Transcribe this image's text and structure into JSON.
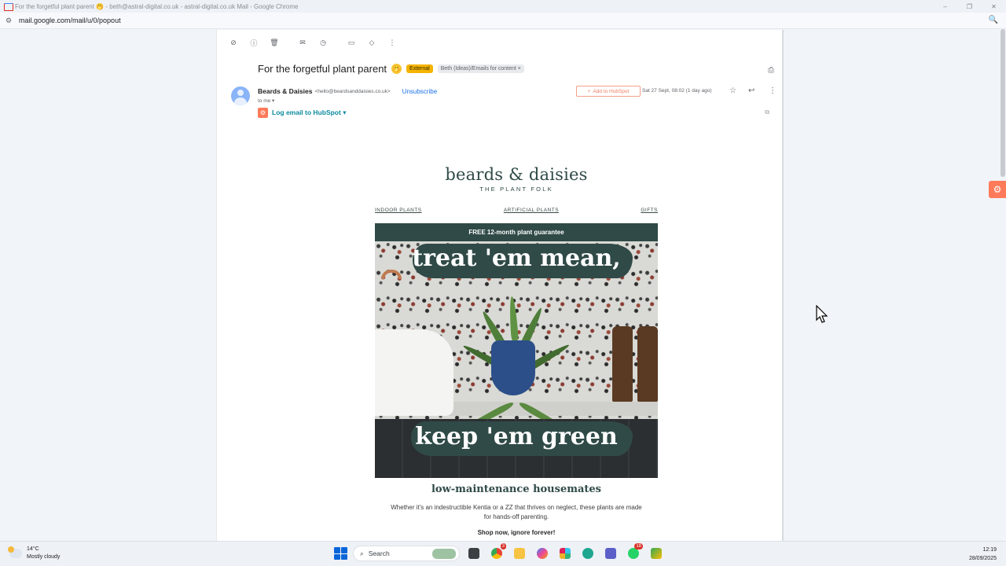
{
  "window": {
    "title": "For the forgetful plant parent 🤭 - beth@astral-digital.co.uk - astral-digital.co.uk Mail - Google Chrome",
    "minimize": "–",
    "maximize": "❐",
    "close": "✕"
  },
  "address_bar": {
    "url": "mail.google.com/mail/u/0/popout"
  },
  "email": {
    "subject": "For the forgetful plant parent",
    "subject_emoji": "🤭",
    "badge_external": "External",
    "label": "Beth (Ideas)/Emails for content",
    "label_close": "×",
    "sender_name": "Beards & Daisies",
    "sender_email": "<hello@beardsanddaisies.co.uk>",
    "unsubscribe": "Unsubscribe",
    "to": "to me ▾",
    "add_hubspot": "Add to HubSpot",
    "date": "Sat 27 Sept, 08:02 (1 day ago)",
    "log_hubspot": "Log email to HubSpot ▾"
  },
  "body": {
    "brand_name": "beards & daisies",
    "brand_tag": "THE PLANT FOLK",
    "nav": [
      "INDOOR PLANTS",
      "ARTIFICIAL PLANTS",
      "GIFTS"
    ],
    "banner": "FREE 12-month plant guarantee",
    "hero_line1": "treat 'em mean,",
    "hero_line2": "keep 'em green",
    "section_title": "low-maintenance housemates",
    "section_body": "Whether it's an indestructible Kentia or a ZZ that thrives on neglect, these plants are made for hands-off parenting.",
    "cta": "Shop now, ignore forever!"
  },
  "taskbar": {
    "temperature": "14°C",
    "weather": "Mostly cloudy",
    "search": "Search",
    "chrome_badge": "3",
    "whatsapp_badge": "18",
    "time": "12:19",
    "date": "28/09/2025"
  },
  "colors": {
    "brand_green": "#2f4a47",
    "hubspot_orange": "#ff7a59",
    "gmail_blue": "#1a73e8",
    "external_badge": "#f4b400"
  }
}
